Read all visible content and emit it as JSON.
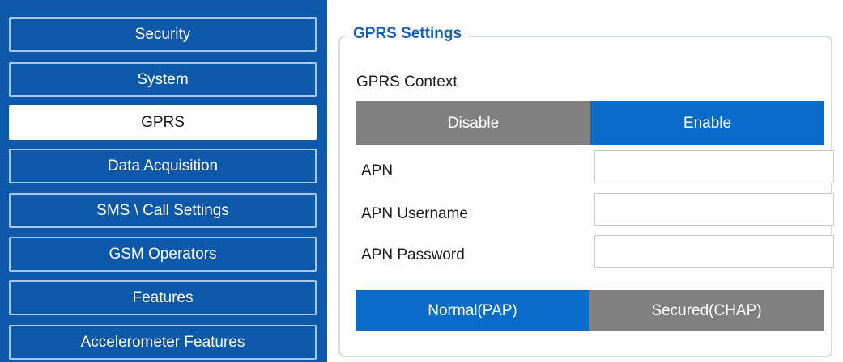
{
  "sidebar": {
    "items": [
      {
        "label": "Security",
        "active": false
      },
      {
        "label": "System",
        "active": false
      },
      {
        "label": "GPRS",
        "active": true
      },
      {
        "label": "Data Acquisition",
        "active": false
      },
      {
        "label": "SMS \\ Call Settings",
        "active": false
      },
      {
        "label": "GSM Operators",
        "active": false
      },
      {
        "label": "Features",
        "active": false
      },
      {
        "label": "Accelerometer Features",
        "active": false
      }
    ]
  },
  "gprs": {
    "title": "GPRS Settings",
    "context_label": "GPRS Context",
    "context_options": {
      "disable": "Disable",
      "enable": "Enable",
      "selected": "Enable"
    },
    "fields": {
      "apn": {
        "label": "APN",
        "value": ""
      },
      "apn_username": {
        "label": "APN Username",
        "value": ""
      },
      "apn_password": {
        "label": "APN Password",
        "value": ""
      }
    },
    "auth_options": {
      "pap": "Normal(PAP)",
      "chap": "Secured(CHAP)",
      "selected": "Normal(PAP)"
    }
  },
  "colors": {
    "sidebar_bg": "#0d58a8",
    "accent_blue": "#0a6cc8",
    "inactive_gray": "#808080",
    "title_blue": "#1560b5"
  }
}
